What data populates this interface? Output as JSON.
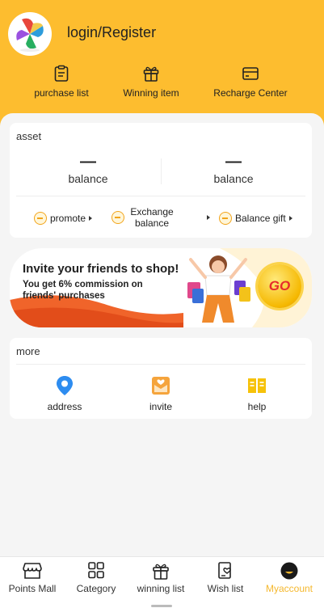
{
  "header": {
    "login_label": "login/Register",
    "quick_links": [
      {
        "label": "purchase list",
        "icon": "clipboard-icon"
      },
      {
        "label": "Winning item",
        "icon": "gift-icon"
      },
      {
        "label": "Recharge Center",
        "icon": "card-icon"
      }
    ]
  },
  "asset": {
    "title": "asset",
    "balances": [
      {
        "value": "—",
        "label": "balance"
      },
      {
        "value": "—",
        "label": "balance"
      }
    ],
    "links": [
      {
        "label": "promote"
      },
      {
        "label_line1": "Exchange",
        "label_line2": "balance"
      },
      {
        "label": "Balance gift"
      }
    ]
  },
  "banner": {
    "headline": "Invite your friends to shop!",
    "subline": "You get 6% commission on friends' purchases",
    "go_label": "GO"
  },
  "more": {
    "title": "more",
    "items": [
      {
        "label": "address",
        "icon": "location-pin-icon"
      },
      {
        "label": "invite",
        "icon": "envelope-icon"
      },
      {
        "label": "help",
        "icon": "book-icon"
      }
    ]
  },
  "tabbar": {
    "tabs": [
      {
        "label": "Points Mall",
        "icon": "store-icon"
      },
      {
        "label": "Category",
        "icon": "grid-icon"
      },
      {
        "label": "winning list",
        "icon": "gift-icon"
      },
      {
        "label": "Wish list",
        "icon": "wishlist-icon"
      },
      {
        "label": "Myaccount",
        "icon": "account-icon"
      }
    ],
    "active_index": 4
  },
  "colors": {
    "brand_yellow": "#fdbd2f",
    "active_tab": "#f5b82e",
    "background": "#f5f5f5"
  }
}
